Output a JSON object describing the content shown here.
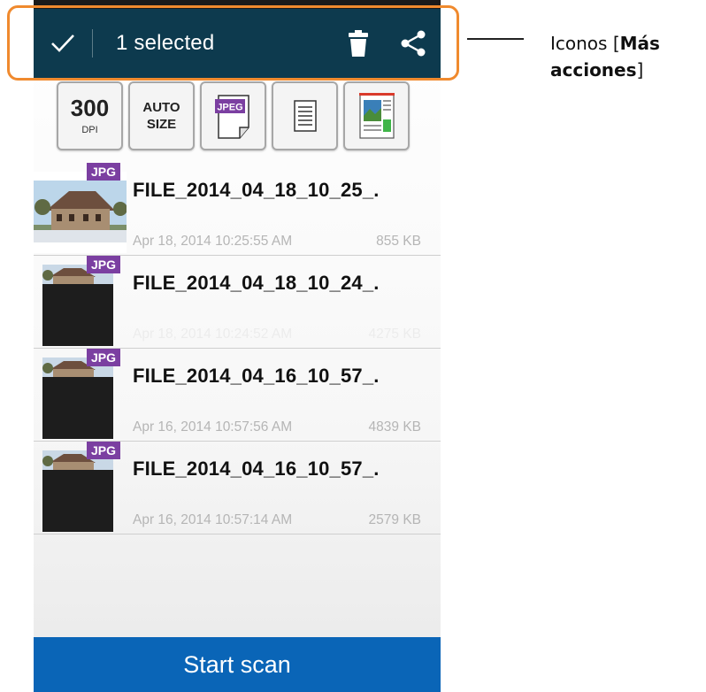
{
  "actionbar": {
    "selected_text": "1 selected",
    "done_icon": "check-icon",
    "delete_icon": "trash-icon",
    "share_icon": "share-icon",
    "background": "#0d3a4e"
  },
  "toolbar": {
    "dpi_value": "300",
    "dpi_label": "DPI",
    "auto_size_line1": "AUTO",
    "auto_size_line2": "SIZE",
    "format_label": "JPEG",
    "document_icon": "document-lines-icon",
    "color_mode_icon": "color-page-icon"
  },
  "files": [
    {
      "badge": "JPG",
      "name": "FILE_2014_04_18_10_25_.",
      "date": "Apr 18, 2014 10:25:55 AM",
      "size": "855 KB",
      "thumb": "house-photo"
    },
    {
      "badge": "JPG",
      "name": "FILE_2014_04_18_10_24_.",
      "date": "Apr 18, 2014 10:24:52 AM",
      "size": "4275 KB",
      "thumb": "dark-scan"
    },
    {
      "badge": "JPG",
      "name": "FILE_2014_04_16_10_57_.",
      "date": "Apr 16, 2014 10:57:56 AM",
      "size": "4839 KB",
      "thumb": "dark-scan"
    },
    {
      "badge": "JPG",
      "name": "FILE_2014_04_16_10_57_.",
      "date": "Apr 16, 2014 10:57:14 AM",
      "size": "2579 KB",
      "thumb": "dark-scan"
    }
  ],
  "start_button": {
    "label": "Start scan",
    "color": "#0a65b7"
  },
  "annotation": {
    "prefix": "Iconos [",
    "bold1": "Más",
    "bold2": "acciones",
    "suffix": "]",
    "border_color": "#f08a2e"
  }
}
